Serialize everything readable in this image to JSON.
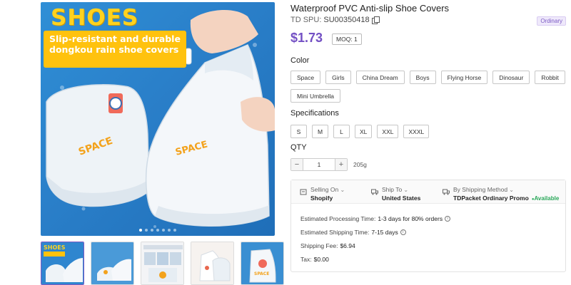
{
  "gallery": {
    "headline": "SHOES",
    "banner_text": "Slip-resistant and durable dongkou rain shoe covers",
    "slide_count": 7,
    "active_slide": 1,
    "thumbnails": [
      {
        "name": "thumb-1",
        "caption": "SHOES"
      },
      {
        "name": "thumb-2",
        "caption": ""
      },
      {
        "name": "thumb-3",
        "caption": ""
      },
      {
        "name": "thumb-4",
        "caption": ""
      },
      {
        "name": "thumb-5",
        "caption": ""
      }
    ]
  },
  "product": {
    "title": "Waterproof PVC Anti-slip Shoe Covers",
    "spu_label": "TD SPU:",
    "spu_value": "SU00350418",
    "badge": "Ordinary",
    "price": "$1.73",
    "moq": "MOQ: 1"
  },
  "color": {
    "label": "Color",
    "options": [
      "Space",
      "Girls",
      "China Dream",
      "Boys",
      "Flying Horse",
      "Dinosaur",
      "Robbit",
      "Mini Umbrella"
    ]
  },
  "specifications": {
    "label": "Specifications",
    "options": [
      "S",
      "M",
      "L",
      "XL",
      "XXL",
      "XXXL"
    ]
  },
  "qty": {
    "label": "QTY",
    "minus": "−",
    "value": "1",
    "plus": "+",
    "weight": "205g"
  },
  "shipping": {
    "selling_on_label": "Selling On",
    "selling_on_value": "Shopify",
    "ship_to_label": "Ship To",
    "ship_to_value": "United States",
    "method_label": "By Shipping Method",
    "method_value": "TDPacket Ordinary Promo",
    "availability": "Available",
    "processing_label": "Estimated Processing Time:",
    "processing_value": "1-3 days for 80% orders",
    "shipping_time_label": "Estimated Shipping Time:",
    "shipping_time_value": "7-15 days",
    "fee_label": "Shipping Fee:",
    "fee_value": "$6.94",
    "tax_label": "Tax:",
    "tax_value": "$0.00"
  },
  "colors": {
    "accent": "#7350c4",
    "available": "#2aa85a",
    "banner": "#ffc20e",
    "photo_bg": "#2a7fc9"
  }
}
